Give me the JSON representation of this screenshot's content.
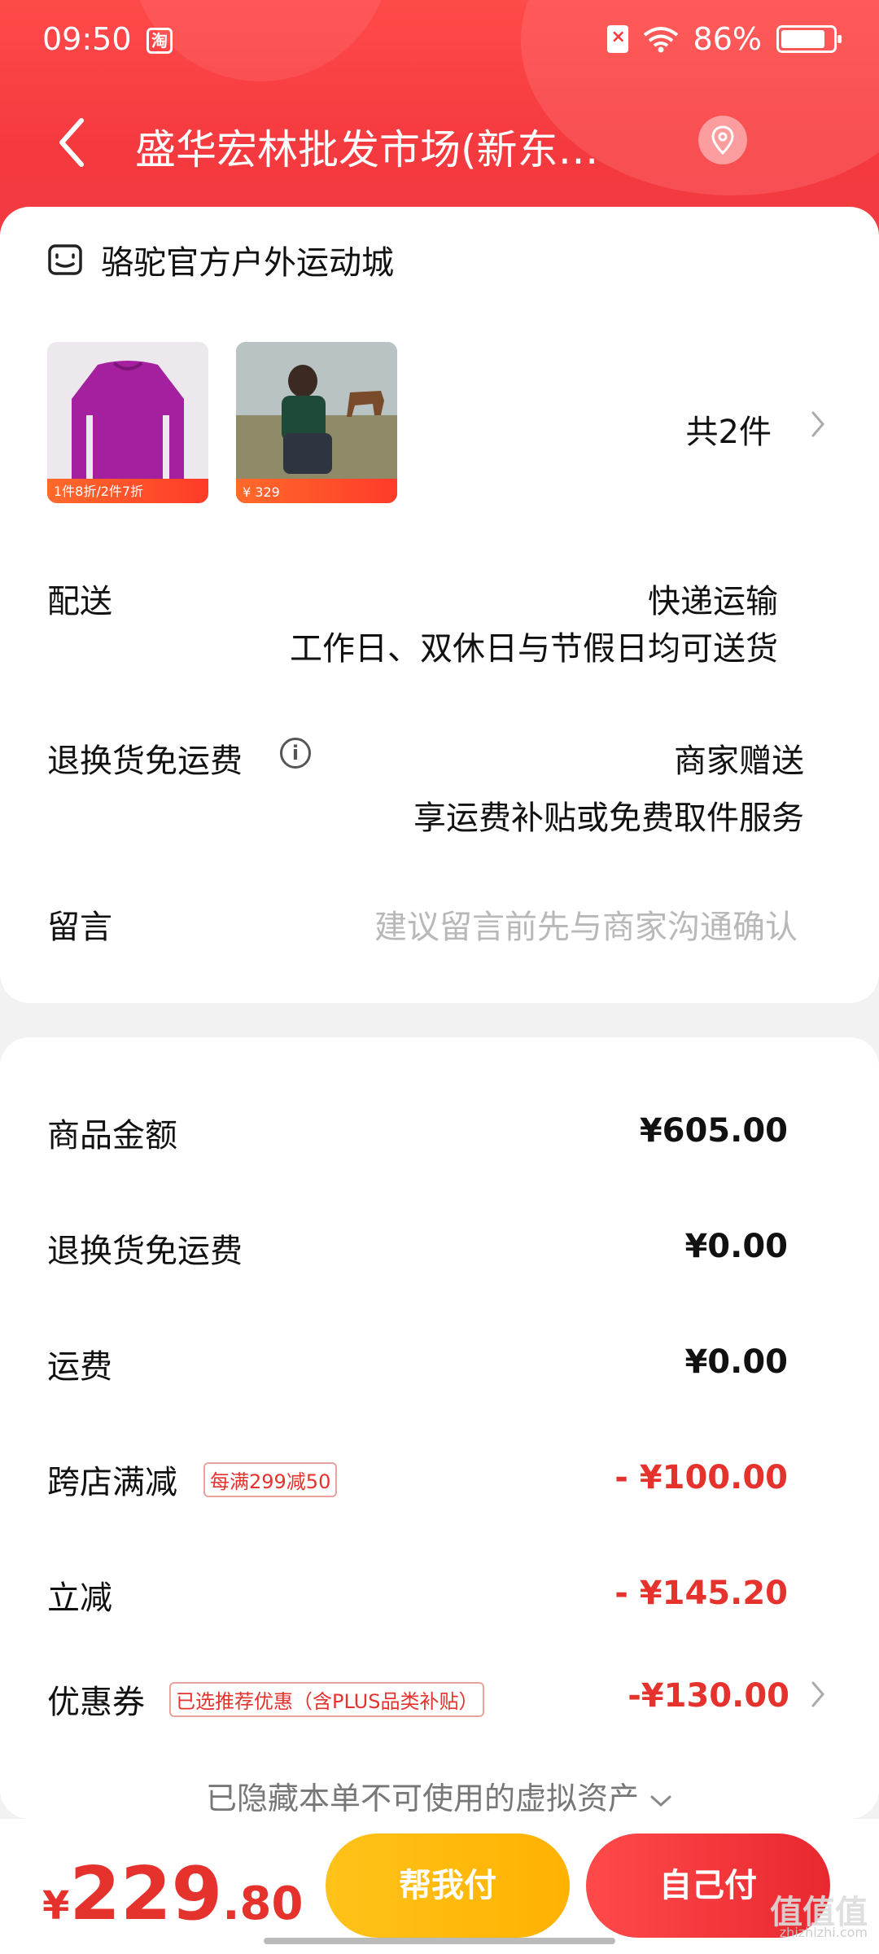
{
  "status_bar": {
    "time": "09:50",
    "app_badge": "淘",
    "battery": "86%",
    "battery_level": 0.86
  },
  "nav": {
    "title": "盛华宏林批发市场(新东…"
  },
  "shop": {
    "name": "骆驼官方户外运动城"
  },
  "items": {
    "thumb1_promo": "1件8折/2件7折",
    "thumb2_price": "¥ 329",
    "total_count": "共2件"
  },
  "delivery": {
    "label": "配送",
    "method": "快递运输",
    "note": "工作日、双休日与节假日均可送货"
  },
  "return_shipping": {
    "label": "退换货免运费",
    "value": "商家赠送",
    "note": "享运费补贴或免费取件服务"
  },
  "message": {
    "label": "留言",
    "placeholder": "建议留言前先与商家沟通确认"
  },
  "price_breakdown": [
    {
      "label": "商品金额",
      "value": "¥605.00"
    },
    {
      "label": "退换货免运费",
      "value": "¥0.00"
    },
    {
      "label": "运费",
      "value": "¥0.00"
    },
    {
      "label": "跨店满减",
      "tag": "每满299减50",
      "value": "- ¥100.00"
    },
    {
      "label": "立减",
      "value": "- ¥145.20"
    },
    {
      "label": "优惠券",
      "tag": "已选推荐优惠（含PLUS品类补贴）",
      "value": "-¥130.00"
    }
  ],
  "hidden_assets": "已隐藏本单不可使用的虚拟资产",
  "bottom": {
    "currency": "¥",
    "total_int": "229",
    "total_dec": ".80",
    "help_pay": "帮我付",
    "self_pay": "自己付"
  },
  "watermark": {
    "text": "值值值",
    "sub": "zhizhizhi.com"
  },
  "colors": {
    "header_red": "#f43a3f",
    "price_red": "#e5322d",
    "help_yellow": "#ffb200"
  }
}
